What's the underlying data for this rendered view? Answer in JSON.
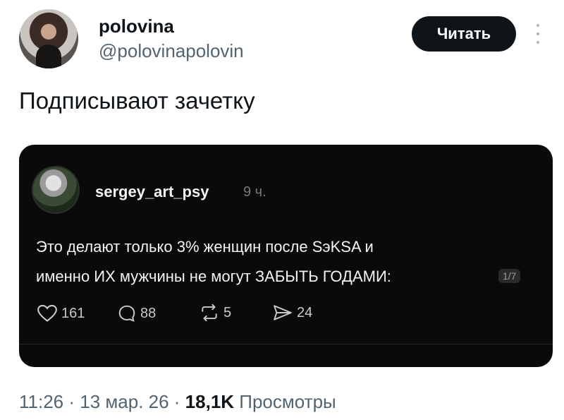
{
  "author": {
    "name": "polovina",
    "handle": "@polovinapolovin",
    "read_button": "Читать"
  },
  "tweet": {
    "text": "Подписывают зачетку"
  },
  "embedded_post": {
    "username": "sergey_art_psy",
    "time": "9 ч.",
    "line1": "Это делают только 3% женщин после SэKSA и",
    "line2": "именно ИХ мужчины не могут ЗАБЫТЬ ГОДАМИ:",
    "page_indicator": "1/7",
    "stats": {
      "likes": "161",
      "comments": "88",
      "reposts": "5",
      "shares": "24"
    }
  },
  "meta": {
    "time": "11:26",
    "sep1": " · ",
    "date": "13 мар. 26",
    "sep2": " · ",
    "views_count": "18,1K",
    "views_label": " Просмотры"
  }
}
